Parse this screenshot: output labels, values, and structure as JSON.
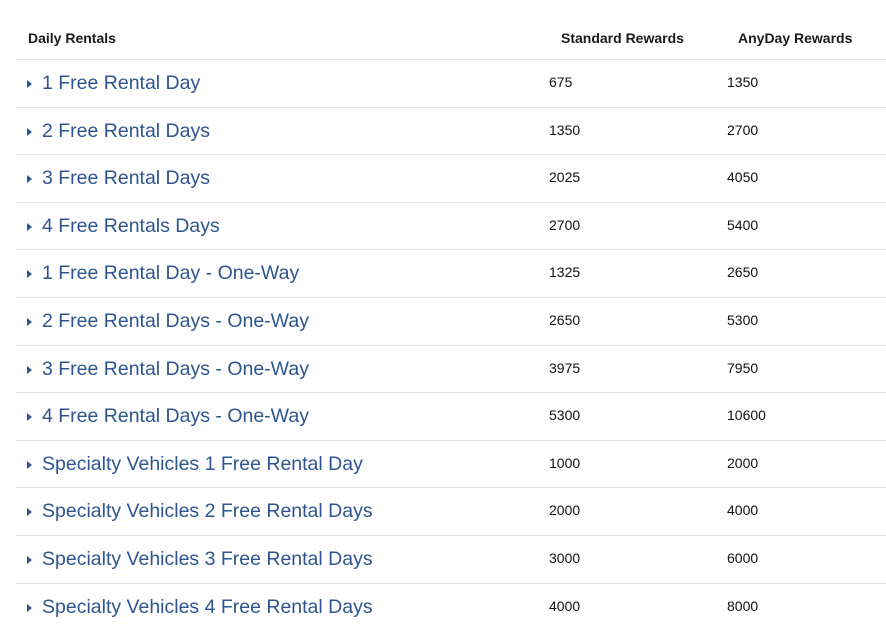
{
  "headers": {
    "col1": "Daily Rentals",
    "col2": "Standard Rewards",
    "col3": "AnyDay Rewards"
  },
  "rows": [
    {
      "label": "1 Free Rental Day",
      "standard": "675",
      "anyday": "1350"
    },
    {
      "label": "2 Free Rental Days",
      "standard": "1350",
      "anyday": "2700"
    },
    {
      "label": "3 Free Rental Days",
      "standard": "2025",
      "anyday": "4050"
    },
    {
      "label": "4 Free Rentals Days",
      "standard": "2700",
      "anyday": "5400"
    },
    {
      "label": "1 Free Rental Day - One-Way",
      "standard": "1325",
      "anyday": "2650"
    },
    {
      "label": "2 Free Rental Days - One-Way",
      "standard": "2650",
      "anyday": "5300"
    },
    {
      "label": "3 Free Rental Days - One-Way",
      "standard": "3975",
      "anyday": "7950"
    },
    {
      "label": "4 Free Rental Days - One-Way",
      "standard": "5300",
      "anyday": "10600"
    },
    {
      "label": "Specialty Vehicles 1 Free Rental Day",
      "standard": "1000",
      "anyday": "2000"
    },
    {
      "label": "Specialty Vehicles 2 Free Rental Days",
      "standard": "2000",
      "anyday": "4000"
    },
    {
      "label": "Specialty Vehicles 3 Free Rental Days",
      "standard": "3000",
      "anyday": "6000"
    },
    {
      "label": "Specialty Vehicles 4 Free Rental Days",
      "standard": "4000",
      "anyday": "8000"
    }
  ],
  "colors": {
    "link": "#2e5590",
    "divider": "#e3e3e3"
  },
  "icons": {
    "row_toggle": "caret-right-icon"
  }
}
